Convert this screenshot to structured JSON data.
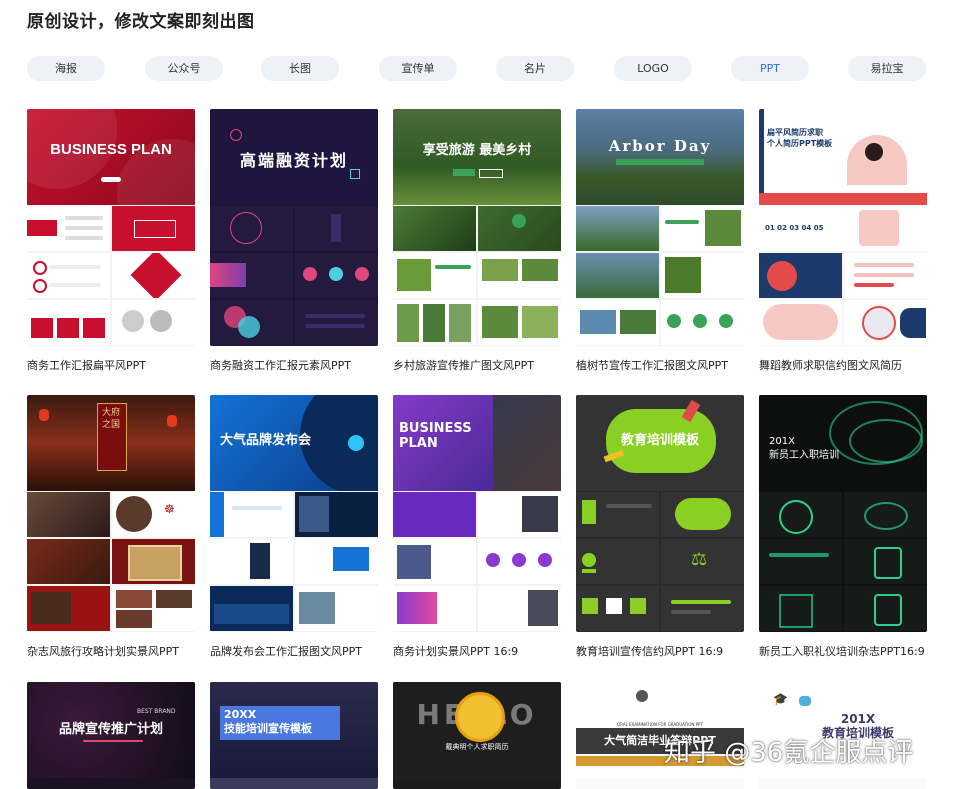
{
  "page_title": "原创设计，修改文案即刻出图",
  "tabs": [
    {
      "label": "海报",
      "active": false
    },
    {
      "label": "公众号",
      "active": false
    },
    {
      "label": "长图",
      "active": false
    },
    {
      "label": "宣传单",
      "active": false
    },
    {
      "label": "名片",
      "active": false
    },
    {
      "label": "LOGO",
      "active": false
    },
    {
      "label": "PPT",
      "active": true
    },
    {
      "label": "易拉宝",
      "active": false
    }
  ],
  "cards": [
    {
      "caption": "商务工作汇报扁平风PPT",
      "cover": "BUSINESS PLAN",
      "theme": "red"
    },
    {
      "caption": "商务融资工作汇报元素风PPT",
      "cover": "高端融资计划",
      "theme": "navy"
    },
    {
      "caption": "乡村旅游宣传推广图文风PPT",
      "cover": "享受旅游 最美乡村",
      "theme": "green"
    },
    {
      "caption": "植树节宣传工作汇报图文风PPT",
      "cover": "Arbor Day",
      "theme": "lake"
    },
    {
      "caption": "舞蹈教师求职信约图文风简历",
      "cover": "扁平风简历求职\n个人简历PPT模板",
      "theme": "coral"
    },
    {
      "caption": "杂志风旅行攻略计划实景风PPT",
      "cover": "大府之国",
      "theme": "darkred"
    },
    {
      "caption": "品牌发布会工作汇报图文风PPT",
      "cover": "大气品牌发布会",
      "theme": "blue"
    },
    {
      "caption": "商务计划实景风PPT 16:9",
      "cover": "BUSINESS\nPLAN",
      "theme": "purple"
    },
    {
      "caption": "教育培训宣传信约风PPT 16:9",
      "cover": "教育培训模板",
      "theme": "chalk"
    },
    {
      "caption": "新员工入职礼仪培训杂志PPT16:9",
      "cover": "201X\n新员工入职培训",
      "theme": "black"
    },
    {
      "caption": "",
      "cover": "品牌宣传推广计划",
      "theme": "night",
      "sub": "BEST BRAND"
    },
    {
      "caption": "",
      "cover": "20XX\n技能培训宣传模板",
      "theme": "indigo"
    },
    {
      "caption": "",
      "cover": "HELLO",
      "theme": "hello",
      "sub": "戴典明个人求职简历"
    },
    {
      "caption": "",
      "cover": "大气简洁毕业答辩PPT",
      "theme": "grad",
      "sub": "ORAL EXAMINATION FOR GRADUATION PPT"
    },
    {
      "caption": "",
      "cover": "201X\n教育培训模板",
      "theme": "edu"
    }
  ],
  "watermark": "知乎 @36氪企服点评",
  "colors": {
    "tab_bg": "#eef1f6",
    "tab_active": "#2f6fd6"
  }
}
